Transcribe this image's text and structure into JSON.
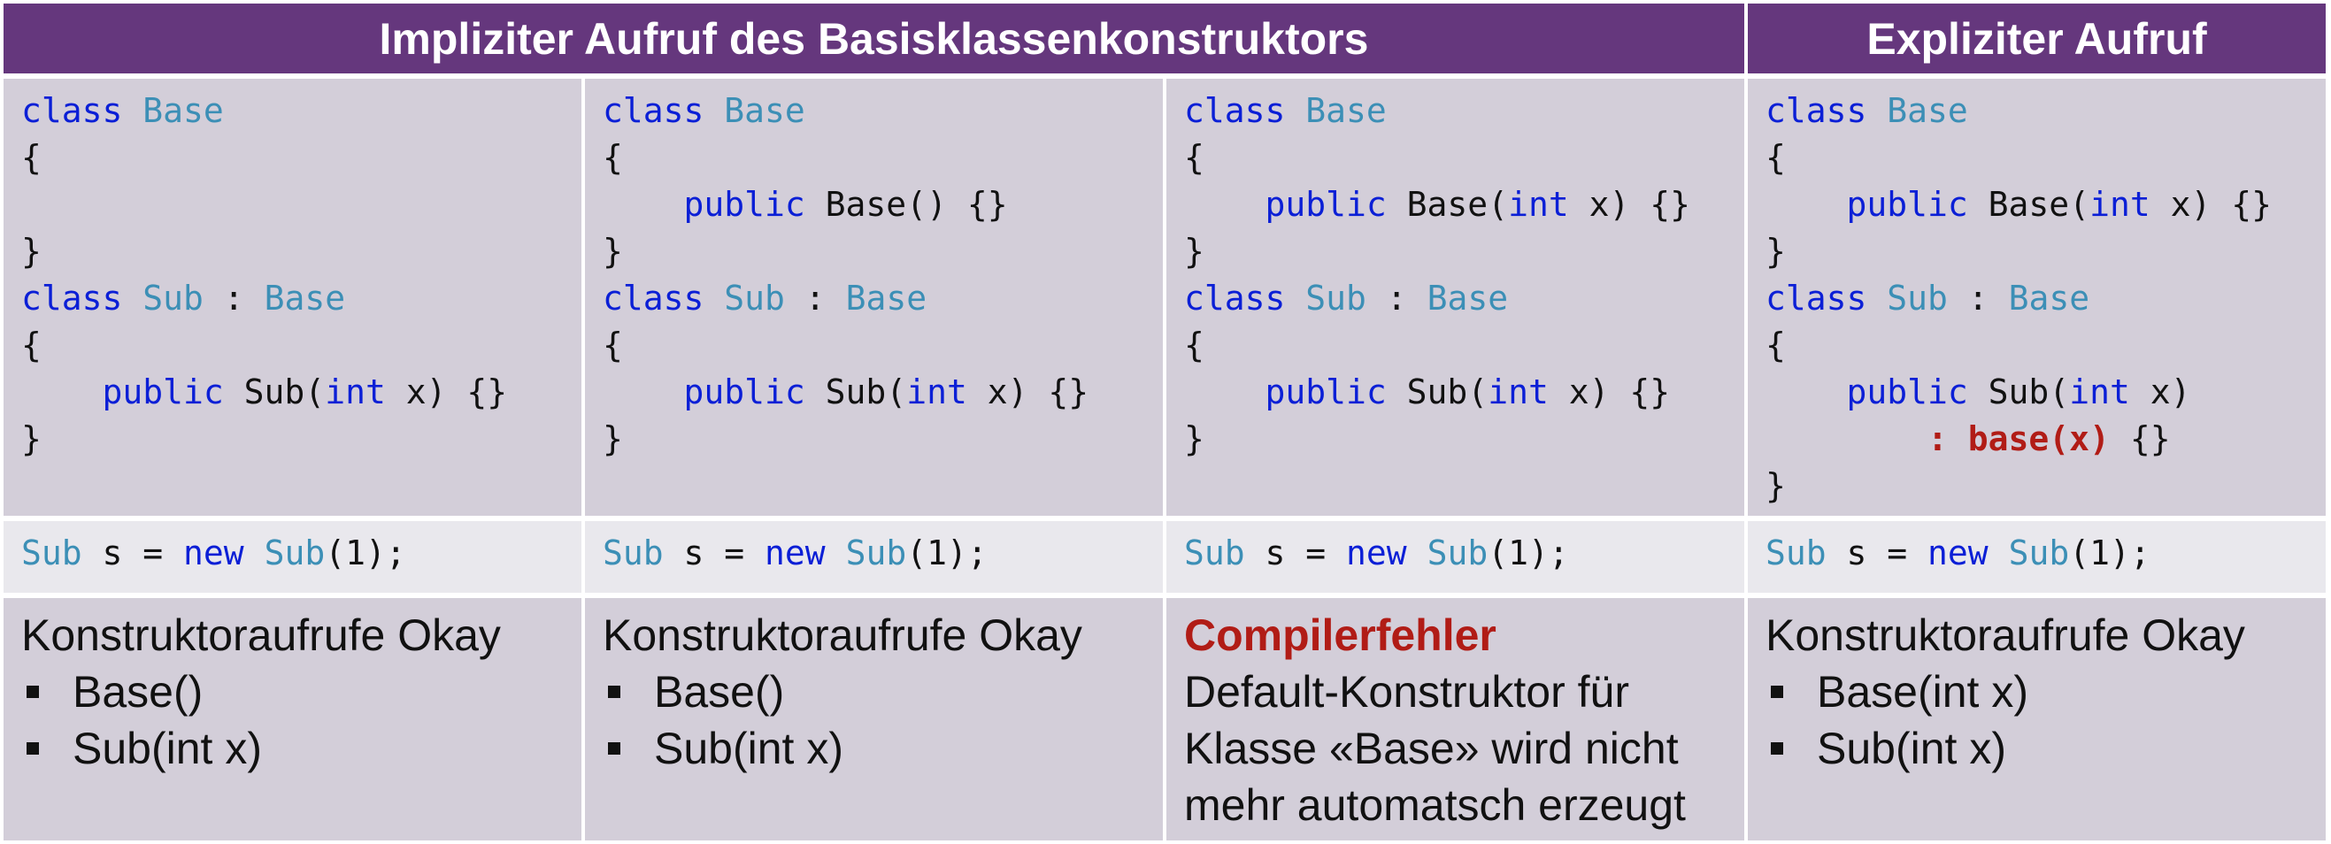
{
  "header": {
    "implicit_title": "Impliziter Aufruf des Basisklassenkonstruktors",
    "explicit_title": "Expliziter Aufruf"
  },
  "columns": [
    {
      "code": [
        [
          [
            "kw",
            "class"
          ],
          [
            "t",
            " "
          ],
          [
            "ty",
            "Base"
          ]
        ],
        [
          [
            "t",
            "{"
          ]
        ],
        [],
        [
          [
            "t",
            "}"
          ]
        ],
        [
          [
            "kw",
            "class"
          ],
          [
            "t",
            " "
          ],
          [
            "ty",
            "Sub"
          ],
          [
            "t",
            " : "
          ],
          [
            "ty",
            "Base"
          ]
        ],
        [
          [
            "t",
            "{"
          ]
        ],
        [
          [
            "t",
            "    "
          ],
          [
            "kw",
            "public"
          ],
          [
            "t",
            " Sub("
          ],
          [
            "kw",
            "int"
          ],
          [
            "t",
            " x) {}"
          ]
        ],
        [
          [
            "t",
            "}"
          ]
        ]
      ],
      "usage": [
        [
          "ty",
          "Sub"
        ],
        [
          "t",
          " s = "
        ],
        [
          "kw",
          "new"
        ],
        [
          "t",
          " "
        ],
        [
          "ty",
          "Sub"
        ],
        [
          "t",
          "(1);"
        ]
      ],
      "result": {
        "title": "Konstruktoraufrufe Okay",
        "is_error": false,
        "bullets": [
          "Base()",
          "Sub(int x)"
        ],
        "lines": []
      }
    },
    {
      "code": [
        [
          [
            "kw",
            "class"
          ],
          [
            "t",
            " "
          ],
          [
            "ty",
            "Base"
          ]
        ],
        [
          [
            "t",
            "{"
          ]
        ],
        [
          [
            "t",
            "    "
          ],
          [
            "kw",
            "public"
          ],
          [
            "t",
            " Base() {}"
          ]
        ],
        [
          [
            "t",
            "}"
          ]
        ],
        [
          [
            "kw",
            "class"
          ],
          [
            "t",
            " "
          ],
          [
            "ty",
            "Sub"
          ],
          [
            "t",
            " : "
          ],
          [
            "ty",
            "Base"
          ]
        ],
        [
          [
            "t",
            "{"
          ]
        ],
        [
          [
            "t",
            "    "
          ],
          [
            "kw",
            "public"
          ],
          [
            "t",
            " Sub("
          ],
          [
            "kw",
            "int"
          ],
          [
            "t",
            " x) {}"
          ]
        ],
        [
          [
            "t",
            "}"
          ]
        ]
      ],
      "usage": [
        [
          "ty",
          "Sub"
        ],
        [
          "t",
          " s = "
        ],
        [
          "kw",
          "new"
        ],
        [
          "t",
          " "
        ],
        [
          "ty",
          "Sub"
        ],
        [
          "t",
          "(1);"
        ]
      ],
      "result": {
        "title": "Konstruktoraufrufe Okay",
        "is_error": false,
        "bullets": [
          "Base()",
          "Sub(int x)"
        ],
        "lines": []
      }
    },
    {
      "code": [
        [
          [
            "kw",
            "class"
          ],
          [
            "t",
            " "
          ],
          [
            "ty",
            "Base"
          ]
        ],
        [
          [
            "t",
            "{"
          ]
        ],
        [
          [
            "t",
            "    "
          ],
          [
            "kw",
            "public"
          ],
          [
            "t",
            " Base("
          ],
          [
            "kw",
            "int"
          ],
          [
            "t",
            " x) {}"
          ]
        ],
        [
          [
            "t",
            "}"
          ]
        ],
        [
          [
            "kw",
            "class"
          ],
          [
            "t",
            " "
          ],
          [
            "ty",
            "Sub"
          ],
          [
            "t",
            " : "
          ],
          [
            "ty",
            "Base"
          ]
        ],
        [
          [
            "t",
            "{"
          ]
        ],
        [
          [
            "t",
            "    "
          ],
          [
            "kw",
            "public"
          ],
          [
            "t",
            " Sub("
          ],
          [
            "kw",
            "int"
          ],
          [
            "t",
            " x) {}"
          ]
        ],
        [
          [
            "t",
            "}"
          ]
        ]
      ],
      "usage": [
        [
          "ty",
          "Sub"
        ],
        [
          "t",
          " s = "
        ],
        [
          "kw",
          "new"
        ],
        [
          "t",
          " "
        ],
        [
          "ty",
          "Sub"
        ],
        [
          "t",
          "(1);"
        ]
      ],
      "result": {
        "title": "Compilerfehler",
        "is_error": true,
        "bullets": [],
        "lines": [
          "Default-Konstruktor für",
          "Klasse «Base» wird nicht",
          "mehr automatsch erzeugt"
        ]
      }
    },
    {
      "code": [
        [
          [
            "kw",
            "class"
          ],
          [
            "t",
            " "
          ],
          [
            "ty",
            "Base"
          ]
        ],
        [
          [
            "t",
            "{"
          ]
        ],
        [
          [
            "t",
            "    "
          ],
          [
            "kw",
            "public"
          ],
          [
            "t",
            " Base("
          ],
          [
            "kw",
            "int"
          ],
          [
            "t",
            " x) {}"
          ]
        ],
        [
          [
            "t",
            "}"
          ]
        ],
        [
          [
            "kw",
            "class"
          ],
          [
            "t",
            " "
          ],
          [
            "ty",
            "Sub"
          ],
          [
            "t",
            " : "
          ],
          [
            "ty",
            "Base"
          ]
        ],
        [
          [
            "t",
            "{"
          ]
        ],
        [
          [
            "t",
            "    "
          ],
          [
            "kw",
            "public"
          ],
          [
            "t",
            " Sub("
          ],
          [
            "kw",
            "int"
          ],
          [
            "t",
            " x)"
          ]
        ],
        [
          [
            "t",
            "        "
          ],
          [
            "er",
            ": base(x)"
          ],
          [
            "t",
            " {}"
          ]
        ],
        [
          [
            "t",
            "}"
          ]
        ]
      ],
      "usage": [
        [
          "ty",
          "Sub"
        ],
        [
          "t",
          " s = "
        ],
        [
          "kw",
          "new"
        ],
        [
          "t",
          " "
        ],
        [
          "ty",
          "Sub"
        ],
        [
          "t",
          "(1);"
        ]
      ],
      "result": {
        "title": "Konstruktoraufrufe Okay",
        "is_error": false,
        "bullets": [
          "Base(int x)",
          "Sub(int x)"
        ],
        "lines": []
      }
    }
  ],
  "colors": {
    "header_bg": "#65377d",
    "cell_bg": "#d3ced9",
    "usage_bg": "#e9e8ed",
    "keyword": "#0b1fd6",
    "type": "#3c8fb6",
    "error": "#b11c16"
  }
}
